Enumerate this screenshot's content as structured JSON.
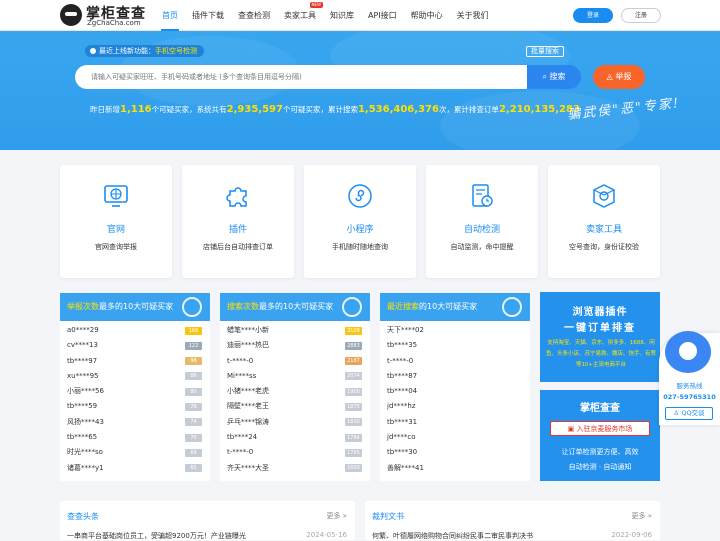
{
  "header": {
    "logo_cn": "掌柜查查",
    "logo_en": "ZgChaCha.com",
    "nav": [
      {
        "label": "首页",
        "active": true
      },
      {
        "label": "插件下载"
      },
      {
        "label": "查查检测"
      },
      {
        "label": "卖家工具",
        "badge": "NEW"
      },
      {
        "label": "知识库"
      },
      {
        "label": "API接口"
      },
      {
        "label": "帮助中心"
      },
      {
        "label": "关于我们"
      }
    ],
    "login": "登录",
    "register": "注册"
  },
  "banner": {
    "notice_prefix": "最近上线新功能：",
    "notice_highlight": "手机空号检测",
    "batch_search": "批量搜索",
    "search_placeholder": "请输入可疑买家旺旺、手机号码或者地址 (多个查询条目用逗号分隔)",
    "search_button": "搜索",
    "report_button": "举报",
    "stats": {
      "t1": "昨日新增",
      "n1": "1,116",
      "t2": "个可疑买家，系统共有",
      "n2": "2,935,597",
      "t3": "个可疑买家，累计搜索",
      "n3": "1,536,406,376",
      "t4": "次，累计排查订单",
      "n4": "2,210,135,283"
    },
    "slogan": "骗武侯\"恶\"专家!"
  },
  "features": [
    {
      "title": "官网",
      "desc": "官网查询举报",
      "icon": "globe-icon"
    },
    {
      "title": "插件",
      "desc": "店铺后台自动排查订单",
      "icon": "puzzle-icon"
    },
    {
      "title": "小程序",
      "desc": "手机随时随地查询",
      "icon": "miniprogram-icon"
    },
    {
      "title": "自动检测",
      "desc": "自动监测，命中提醒",
      "icon": "auto-detect-icon"
    },
    {
      "title": "卖家工具",
      "desc": "空号查询，身份证校验",
      "icon": "tools-icon"
    }
  ],
  "lists": [
    {
      "title_pre": "",
      "title_hl": "举报次数",
      "title_post": "最多的10大可疑买家",
      "rows": [
        {
          "name": "a0****29",
          "count": "166"
        },
        {
          "name": "cv****13",
          "count": "122"
        },
        {
          "name": "tb****97",
          "count": "98"
        },
        {
          "name": "xu****95",
          "count": "86"
        },
        {
          "name": "小丽****56",
          "count": "80"
        },
        {
          "name": "tb****59",
          "count": "76"
        },
        {
          "name": "风扬****43",
          "count": "74"
        },
        {
          "name": "tb****65",
          "count": "70"
        },
        {
          "name": "时光****so",
          "count": "69"
        },
        {
          "name": "诸葛****y1",
          "count": "65"
        }
      ]
    },
    {
      "title_pre": "",
      "title_hl": "搜索次数",
      "title_post": "最多的10大可疑买家",
      "rows": [
        {
          "name": "蜡笔****小新",
          "count": "3109"
        },
        {
          "name": "迪丽****热巴",
          "count": "2883"
        },
        {
          "name": "t-****-0",
          "count": "2187"
        },
        {
          "name": "Mi****ss",
          "count": "2074"
        },
        {
          "name": "小猪****老虎",
          "count": "1900"
        },
        {
          "name": "隔壁****老王",
          "count": "1875"
        },
        {
          "name": "乒乓****锦涛",
          "count": "1830"
        },
        {
          "name": "tb****24",
          "count": "1784"
        },
        {
          "name": "t-****-0",
          "count": "1765"
        },
        {
          "name": "齐天****大圣",
          "count": "1693"
        }
      ]
    },
    {
      "title_pre": "",
      "title_hl": "最近搜索",
      "title_post": "的10大可疑买家",
      "rows": [
        {
          "name": "天下****02",
          "count": ""
        },
        {
          "name": "tb****35",
          "count": ""
        },
        {
          "name": "t-****-0",
          "count": ""
        },
        {
          "name": "tb****87",
          "count": ""
        },
        {
          "name": "tb****04",
          "count": ""
        },
        {
          "name": "jd****hz",
          "count": ""
        },
        {
          "name": "tb****31",
          "count": ""
        },
        {
          "name": "jd****co",
          "count": ""
        },
        {
          "name": "tb****30",
          "count": ""
        },
        {
          "name": "善解****41",
          "count": ""
        }
      ]
    }
  ],
  "promo1": {
    "line1": "浏览器插件",
    "line2": "一键订单排查",
    "line3": "支持淘宝、天猫、京东、拼多多、1688、闲鱼、头条小店、苏宁易购、魏店、快手、有赞等10+主流电商平台"
  },
  "promo2": {
    "title": "掌柜查查",
    "button": "入驻京麦服务市场",
    "line1": "让订单检测更方便、高效",
    "line2": "自动检测 · 自动通知"
  },
  "service": {
    "label": "服务热线",
    "phone": "027-59765310",
    "qq": "QQ交谈"
  },
  "news": [
    {
      "title": "查查头条",
      "more": "更多",
      "item": "一串商平台基础岗位员工，受骗超9200万元！产业链曝光",
      "date": "2024-05-16"
    },
    {
      "title": "裁判文书",
      "more": "更多",
      "item": "何繁、叶德履网络购物合同纠纷民事二审民事判决书",
      "date": "2022-09-06"
    }
  ],
  "colors": {
    "primary": "#1a8cf0",
    "banner": "#38a6ef",
    "report": "#f7652b",
    "highlight": "#ffe300"
  }
}
